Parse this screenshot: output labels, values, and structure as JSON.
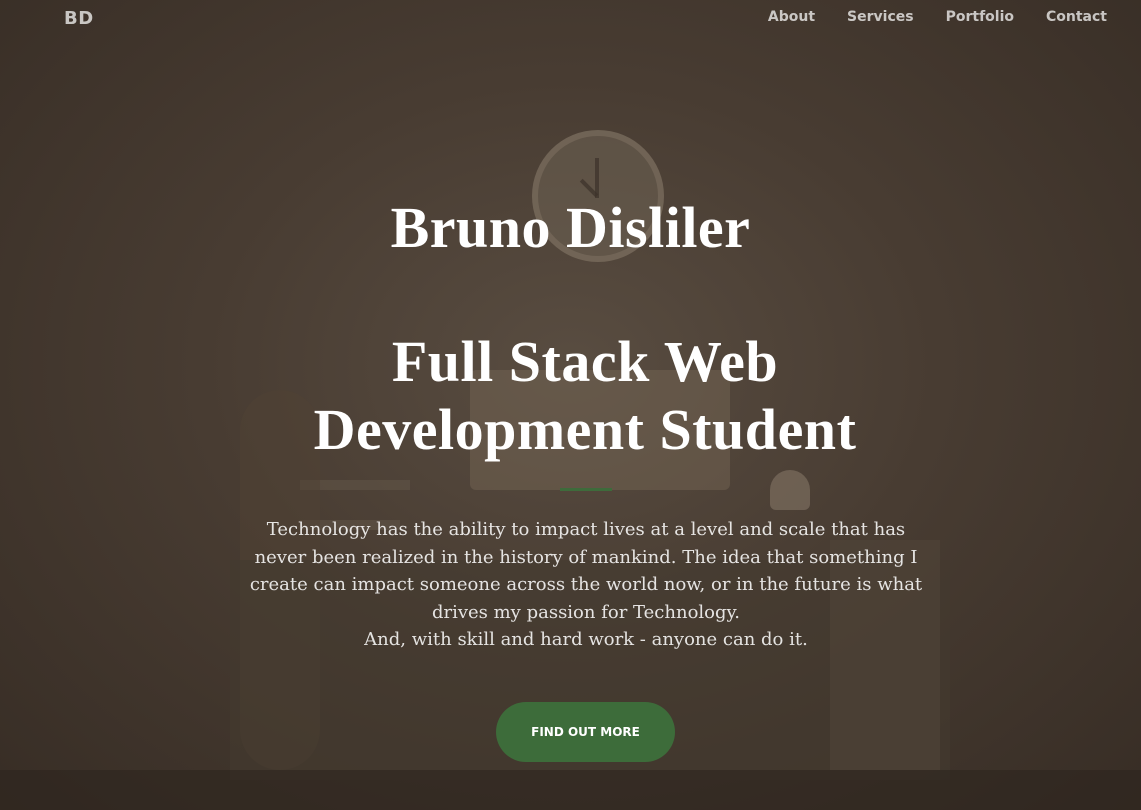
{
  "nav": {
    "brand": "BD",
    "links": [
      "About",
      "Services",
      "Portfolio",
      "Contact"
    ]
  },
  "hero": {
    "name": "Bruno Disliler",
    "role": "Full Stack Web Development Student",
    "bio_line1": "Technology has the ability to impact lives at a level and scale that has never been realized in the history of mankind. The idea that something I create can impact someone across the world now, or in the future is what drives my passion for Technology.",
    "bio_line2": "And, with skill and hard work - anyone can do it.",
    "cta_label": "FIND OUT MORE"
  },
  "colors": {
    "accent": "#3d6c3a",
    "background": "#4d4036"
  }
}
